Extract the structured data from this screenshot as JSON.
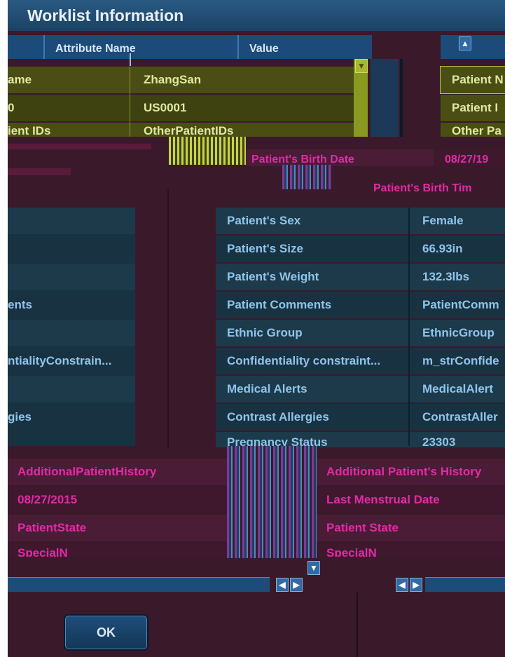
{
  "dialog": {
    "title": "Worklist Information",
    "ok_label": "OK"
  },
  "header": {
    "attribute_col": "Attribute Name",
    "value_col": "Value"
  },
  "olive_rows": [
    {
      "left": "ame",
      "right": "ZhangSan",
      "far": "Patient N"
    },
    {
      "left": "0",
      "right": "US0001",
      "far": "Patient I"
    },
    {
      "left": "ient IDs",
      "right": "OtherPatientIDs",
      "far": "Other Pa"
    }
  ],
  "glitch_rows": [
    {
      "label": "Patient's Birth Date",
      "value": "08/27/19"
    },
    {
      "label": "Patient's Birth Tim",
      "value": ""
    }
  ],
  "teal_rows": [
    {
      "left": "",
      "attr": "Patient's Sex",
      "value": "Female"
    },
    {
      "left": "",
      "attr": "Patient's Size",
      "value": "66.93in"
    },
    {
      "left": "",
      "attr": "Patient's Weight",
      "value": "132.3lbs"
    },
    {
      "left": "ents",
      "attr": "Patient Comments",
      "value": "PatientComm"
    },
    {
      "left": "",
      "attr": "Ethnic Group",
      "value": "EthnicGroup"
    },
    {
      "left": "ntialityConstrain...",
      "attr": "Confidentiality constraint...",
      "value": "m_strConfide"
    },
    {
      "left": "",
      "attr": "Medical Alerts",
      "value": "MedicalAlert"
    },
    {
      "left": "gies",
      "attr": "Contrast Allergies",
      "value": "ContrastAller"
    },
    {
      "left": "",
      "attr": "Pregnancy Status",
      "value": "23303"
    }
  ],
  "magenta_rows": [
    {
      "left": "AdditionalPatientHistory",
      "right": "Additional Patient's History"
    },
    {
      "left": "08/27/2015",
      "right": "Last Menstrual Date"
    },
    {
      "left": "PatientState",
      "right": "Patient State"
    },
    {
      "left": "SpecialN",
      "right": "SpecialN"
    }
  ],
  "colors": {
    "olive_bg": "#4a4e14",
    "teal_bg": "#1c3a4a",
    "magenta_bg": "#4a1c36",
    "header_bg": "#1c4a7a",
    "frame_bg": "#3a1a2a"
  },
  "icons": [
    "scroll-up-icon",
    "scroll-down-icon",
    "scroll-left-icon",
    "scroll-right-icon"
  ]
}
